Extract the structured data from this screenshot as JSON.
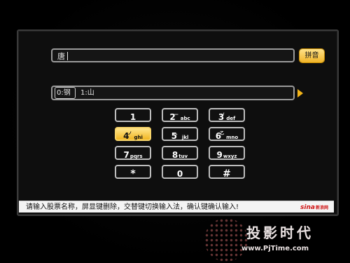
{
  "input": {
    "text": "唐"
  },
  "mode_button": {
    "label": "拼音"
  },
  "candidates": {
    "selected": "0:钢",
    "items": [
      "1:山"
    ]
  },
  "keypad": {
    "keys": [
      {
        "num": "1",
        "letters": "",
        "sup": ""
      },
      {
        "num": "2",
        "letters": "abc",
        "sup": "—"
      },
      {
        "num": "3",
        "letters": "def",
        "sup": "/"
      },
      {
        "num": "4",
        "letters": "ghi",
        "sup": "ノ",
        "active": true
      },
      {
        "num": "5",
        "letters": "jkl",
        "sup": "、"
      },
      {
        "num": "6",
        "letters": "mno",
        "sup": "乙"
      },
      {
        "num": "7",
        "letters": "pqrs",
        "sup": ""
      },
      {
        "num": "8",
        "letters": "tuv",
        "sup": ""
      },
      {
        "num": "9",
        "letters": "wxyz",
        "sup": ""
      },
      {
        "num": "*",
        "letters": "",
        "sup": ""
      },
      {
        "num": "0",
        "letters": "",
        "sup": ""
      },
      {
        "num": "#",
        "letters": "",
        "sup": ""
      }
    ]
  },
  "status": {
    "text": "请输入股票名称，屏显键删除，交替键切换输入法，确认键确认输入!",
    "brand": "sina",
    "brand_sub": "新浪网"
  },
  "watermark": {
    "text": "投影时代",
    "url": "www.PjTime.com"
  },
  "colors": {
    "accent": "#f1b522",
    "frame": "#9a9a9a",
    "background": "#000000"
  }
}
